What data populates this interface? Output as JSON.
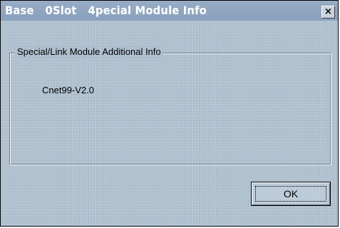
{
  "window": {
    "title": "Base   0Slot   4pecial Module Info",
    "close_label": "×"
  },
  "group": {
    "legend": "Special/Link Module Additional Info",
    "value": "Cnet99-V2.0"
  },
  "buttons": {
    "ok_label": "OK"
  },
  "colors": {
    "dialog_bg": "#aec0cf",
    "titlebar_bg": "#8fa5c0",
    "title_text": "#ffffff"
  }
}
